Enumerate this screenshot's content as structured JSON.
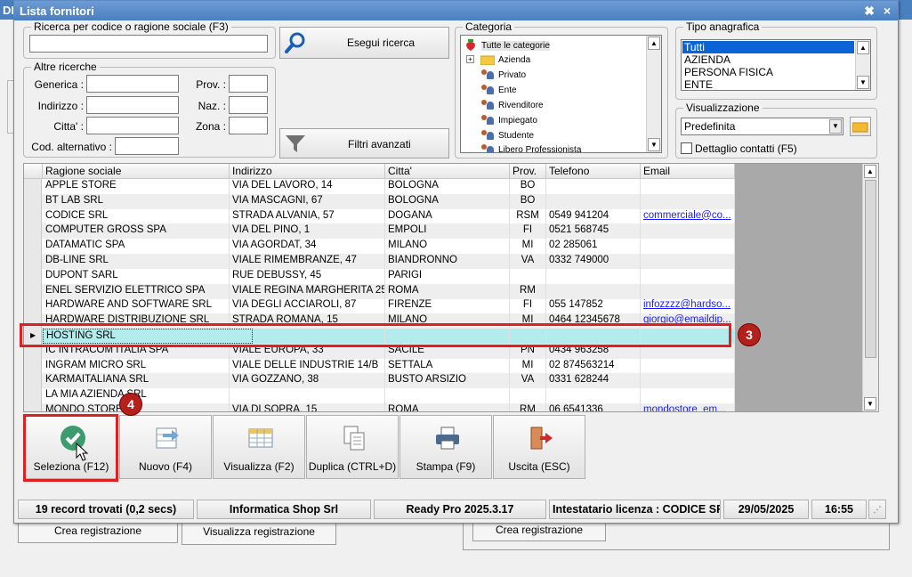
{
  "window": {
    "title": "Lista fornitori",
    "behind_prefix": "DE",
    "close_glyph": "×",
    "pin_glyph": "✖"
  },
  "search": {
    "group_label": "Ricerca per codice o ragione sociale (F3)",
    "value": "",
    "button_label": "Esegui ricerca"
  },
  "other_search": {
    "group_label": "Altre ricerche",
    "fields": {
      "generica": "Generica :",
      "indirizzo": "Indirizzo :",
      "citta": "Citta' :",
      "cod_alt": "Cod. alternativo :",
      "prov": "Prov. :",
      "naz": "Naz. :",
      "zona": "Zona :"
    },
    "filters_button": "Filtri avanzati"
  },
  "categoria": {
    "group_label": "Categoria",
    "root": "Tutte le categorie",
    "items": [
      "Azienda",
      "Privato",
      "Ente",
      "Rivenditore",
      "Impiegato",
      "Studente",
      "Libero Professionista"
    ]
  },
  "tipo": {
    "group_label": "Tipo anagrafica",
    "options": [
      "Tutti",
      "AZIENDA",
      "PERSONA FISICA",
      "ENTE"
    ],
    "selected": "Tutti"
  },
  "visualizzazione": {
    "group_label": "Visualizzazione",
    "selected": "Predefinita",
    "checkbox_label": "Dettaglio contatti (F5)"
  },
  "grid": {
    "columns": [
      "Ragione sociale",
      "Indirizzo",
      "Citta'",
      "Prov.",
      "Telefono",
      "Email"
    ],
    "rows": [
      {
        "name": "APPLE STORE",
        "address": "VIA DEL LAVORO, 14",
        "city": "BOLOGNA",
        "prov": "BO",
        "phone": "",
        "email": ""
      },
      {
        "name": "BT LAB SRL",
        "address": "VIA MASCAGNI, 67",
        "city": "BOLOGNA",
        "prov": "BO",
        "phone": "",
        "email": ""
      },
      {
        "name": "CODICE SRL",
        "address": "STRADA ALVANIA, 57",
        "city": "DOGANA",
        "prov": "RSM",
        "phone": "0549 941204",
        "email": "commerciale@co..."
      },
      {
        "name": "COMPUTER GROSS SPA",
        "address": "VIA DEL PINO, 1",
        "city": "EMPOLI",
        "prov": "FI",
        "phone": "0521 568745",
        "email": ""
      },
      {
        "name": "DATAMATIC SPA",
        "address": "VIA AGORDAT, 34",
        "city": "MILANO",
        "prov": "MI",
        "phone": "02 285061",
        "email": ""
      },
      {
        "name": "DB-LINE SRL",
        "address": "VIALE RIMEMBRANZE, 47",
        "city": "BIANDRONNO",
        "prov": "VA",
        "phone": "0332 749000",
        "email": ""
      },
      {
        "name": "DUPONT SARL",
        "address": "RUE DEBUSSY, 45",
        "city": "PARIGI",
        "prov": "",
        "phone": "",
        "email": ""
      },
      {
        "name": "ENEL SERVIZIO ELETTRICO SPA",
        "address": "VIALE REGINA MARGHERITA 25",
        "city": "ROMA",
        "prov": "RM",
        "phone": "",
        "email": ""
      },
      {
        "name": "HARDWARE AND SOFTWARE SRL",
        "address": "VIA DEGLI ACCIAROLI, 87",
        "city": "FIRENZE",
        "prov": "FI",
        "phone": "055 147852",
        "email": "infozzzz@hardso..."
      },
      {
        "name": "HARDWARE DISTRIBUZIONE SRL",
        "address": "STRADA ROMANA, 15",
        "city": "MILANO",
        "prov": "MI",
        "phone": "0464 12345678",
        "email": "giorgio@emaildip..."
      },
      {
        "name": "HOSTING SRL",
        "address": "",
        "city": "",
        "prov": "",
        "phone": "",
        "email": ""
      },
      {
        "name": "IC INTRACOM ITALIA SPA",
        "address": "VIALE EUROPA, 33",
        "city": "SACILE",
        "prov": "PN",
        "phone": "0434 963258",
        "email": ""
      },
      {
        "name": "INGRAM MICRO SRL",
        "address": "VIALE DELLE INDUSTRIE 14/B",
        "city": "SETTALA",
        "prov": "MI",
        "phone": "02 874563214",
        "email": ""
      },
      {
        "name": "KARMAITALIANA SRL",
        "address": "VIA GOZZANO, 38",
        "city": "BUSTO ARSIZIO",
        "prov": "VA",
        "phone": "0331 628244",
        "email": ""
      },
      {
        "name": "LA MIA AZIENDA SRL",
        "address": "",
        "city": "",
        "prov": "",
        "phone": "",
        "email": ""
      },
      {
        "name": "MONDO STORE",
        "address": "VIA DI SOPRA, 15",
        "city": "ROMA",
        "prov": "RM",
        "phone": "06 6541336",
        "email": "mondostore_em..."
      }
    ],
    "selected_row": "HOSTING SRL"
  },
  "toolbar": {
    "select": "Seleziona (F12)",
    "new": "Nuovo (F4)",
    "view": "Visualizza (F2)",
    "duplicate": "Duplica (CTRL+D)",
    "print": "Stampa (F9)",
    "exit": "Uscita (ESC)"
  },
  "status": {
    "records": "19 record trovati (0,2 secs)",
    "company": "Informatica Shop Srl",
    "version": "Ready Pro 2025.3.17",
    "license": "Intestatario licenza : CODICE SRL",
    "date": "29/05/2025",
    "time": "16:55"
  },
  "background": {
    "btn1": "Crea registrazione",
    "btn2": "Visualizza registrazione",
    "btn3": "Crea registrazione"
  },
  "annotations": {
    "badge3": "3",
    "badge4": "4"
  },
  "colors": {
    "accent": "#4a7fc0",
    "selected_row": "#b2ecec",
    "highlight": "#e02020",
    "badge": "#b5201a"
  }
}
